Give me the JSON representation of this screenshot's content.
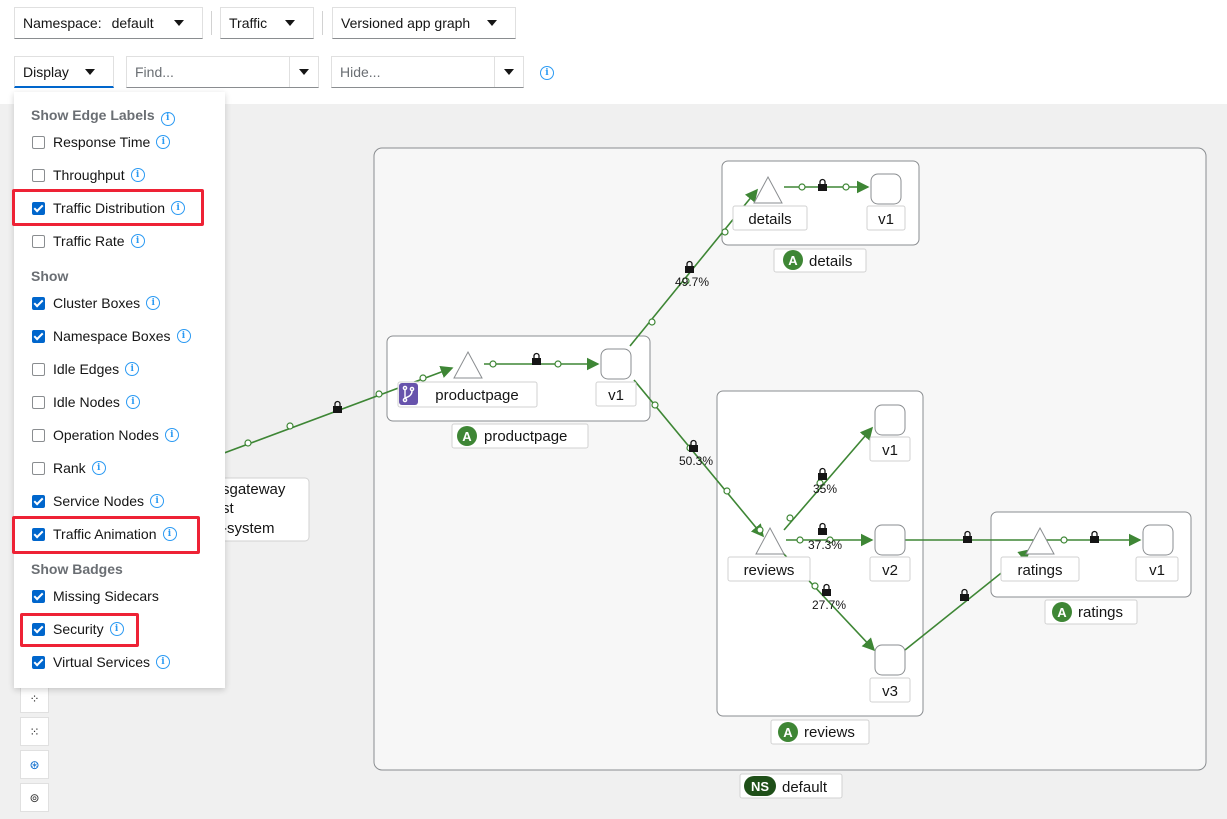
{
  "toolbar": {
    "namespace_label": "Namespace:",
    "namespace_value": "default",
    "traffic": "Traffic",
    "graph_type": "Versioned app graph",
    "display": "Display",
    "find_placeholder": "Find...",
    "hide_placeholder": "Hide..."
  },
  "display_menu": {
    "edge_labels_header": "Show Edge Labels",
    "edge_labels": [
      {
        "label": "Response Time",
        "checked": false
      },
      {
        "label": "Throughput",
        "checked": false
      },
      {
        "label": "Traffic Distribution",
        "checked": true
      },
      {
        "label": "Traffic Rate",
        "checked": false
      }
    ],
    "show_header": "Show",
    "show": [
      {
        "label": "Cluster Boxes",
        "checked": true
      },
      {
        "label": "Namespace Boxes",
        "checked": true
      },
      {
        "label": "Idle Edges",
        "checked": false
      },
      {
        "label": "Idle Nodes",
        "checked": false
      },
      {
        "label": "Operation Nodes",
        "checked": false
      },
      {
        "label": "Rank",
        "checked": false
      },
      {
        "label": "Service Nodes",
        "checked": true
      },
      {
        "label": "Traffic Animation",
        "checked": true
      }
    ],
    "badges_header": "Show Badges",
    "badges": [
      {
        "label": "Missing Sidecars",
        "checked": true
      },
      {
        "label": "Security",
        "checked": true
      },
      {
        "label": "Virtual Services",
        "checked": true
      }
    ]
  },
  "graph": {
    "namespace_badge": "NS",
    "namespace_name": "default",
    "app_badge": "A",
    "apps": {
      "details": "details",
      "productpage": "productpage",
      "reviews": "reviews",
      "ratings": "ratings"
    },
    "nodes": {
      "details_svc": "details",
      "details_v1": "v1",
      "productpage_svc": "productpage",
      "productpage_v1": "v1",
      "reviews_svc": "reviews",
      "reviews_v1": "v1",
      "reviews_v2": "v2",
      "reviews_v3": "v3",
      "ratings_svc": "ratings",
      "ratings_v1": "v1"
    },
    "ingress_lines": [
      "sgateway",
      "st",
      "-system"
    ],
    "edge_labels": {
      "to_details": "49.7%",
      "to_reviews": "50.3%",
      "reviews_v1": "35%",
      "reviews_v2": "37.3%",
      "reviews_v3": "27.7%"
    },
    "edge_color": "#3e8635",
    "badge_color": "#3e8635"
  }
}
